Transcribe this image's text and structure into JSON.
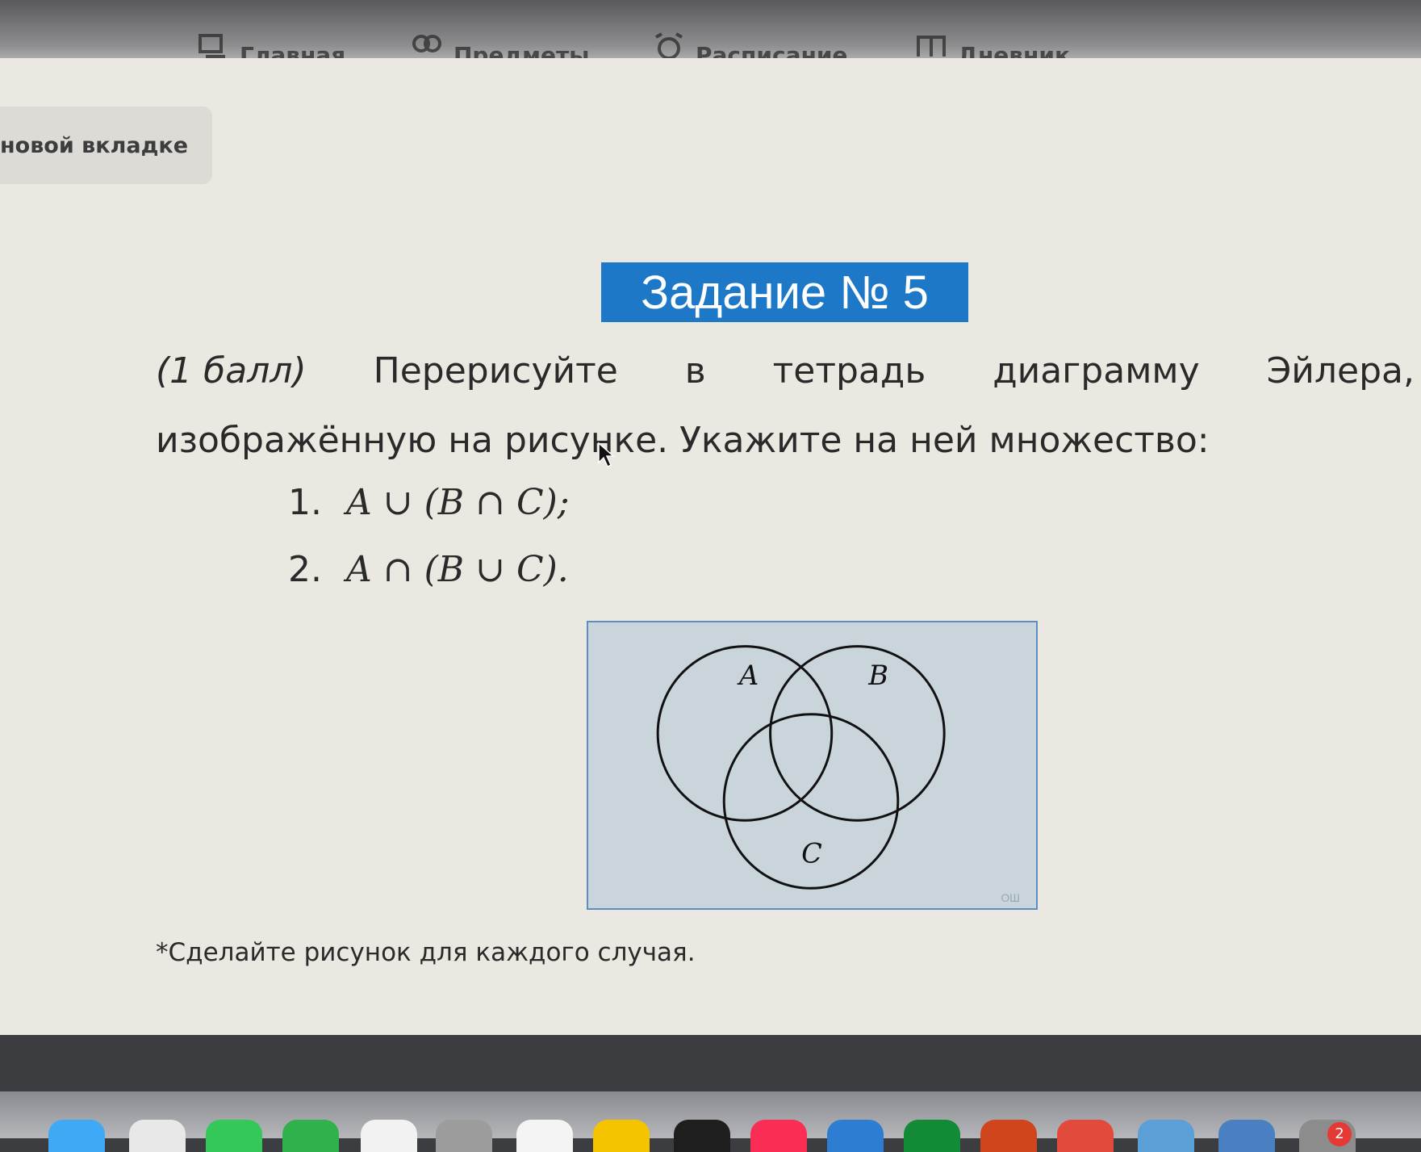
{
  "nav": {
    "items": [
      {
        "label": "Главная",
        "icon": "home-icon"
      },
      {
        "label": "Предметы",
        "icon": "subjects-icon"
      },
      {
        "label": "Расписание",
        "icon": "alarm-clock-icon"
      },
      {
        "label": "Дневник",
        "icon": "book-icon"
      }
    ]
  },
  "tab_hint": "новой вкладке",
  "task": {
    "title": "Задание № 5",
    "points": "(1 балл)",
    "line1_words": [
      "Перерисуйте",
      "в",
      "тетрадь",
      "диаграмму",
      "Эйлера,"
    ],
    "line2": "изображённую на рисунке. Укажите на ней множество:",
    "items": [
      {
        "num": "1.",
        "expr": "A ∪ (B ∩ C);"
      },
      {
        "num": "2.",
        "expr": "A ∩ (B ∪ C)."
      }
    ],
    "footnote": "*Сделайте рисунок для каждого случая."
  },
  "diagram": {
    "labels": {
      "a": "A",
      "b": "B",
      "c": "C"
    },
    "watermark": "ОШ",
    "background": "#c9d4db",
    "border": "#5b8ec2"
  },
  "colors": {
    "accent": "#1d78c8",
    "page": "#eae8e1"
  },
  "dock": {
    "badge": "2"
  }
}
